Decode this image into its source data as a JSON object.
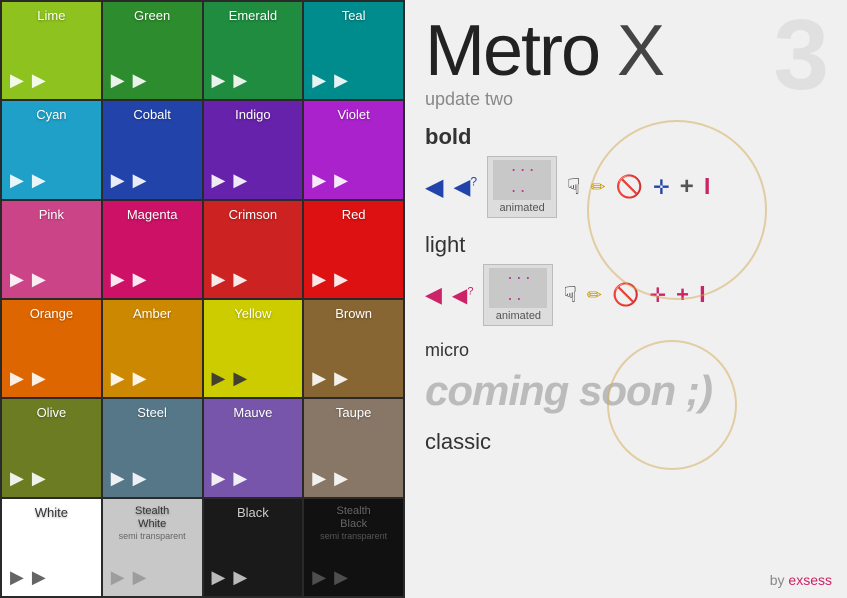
{
  "app": {
    "title": "Metro X",
    "title_prefix": "Metro ",
    "title_x": "X",
    "badge": "3",
    "subtitle": "update two",
    "by": "by exsess"
  },
  "sections": [
    {
      "id": "bold",
      "label": "bold",
      "type": "cursor-row",
      "animated_label": "animated"
    },
    {
      "id": "light",
      "label": "light",
      "type": "cursor-row",
      "animated_label": "animated"
    },
    {
      "id": "micro",
      "label": "micro",
      "type": "coming-soon",
      "coming_soon_text": "coming soon ;)"
    },
    {
      "id": "classic",
      "label": "classic",
      "type": "classic"
    }
  ],
  "color_tiles": [
    {
      "label": "Lime",
      "bg": "#8dc21f",
      "row": 1,
      "col": 1
    },
    {
      "label": "Green",
      "bg": "#2d8c2d",
      "row": 1,
      "col": 2
    },
    {
      "label": "Emerald",
      "bg": "#1f8c3f",
      "row": 1,
      "col": 3
    },
    {
      "label": "Teal",
      "bg": "#008c8c",
      "row": 1,
      "col": 4
    },
    {
      "label": "Cyan",
      "bg": "#1fa0c8",
      "row": 2,
      "col": 1
    },
    {
      "label": "Cobalt",
      "bg": "#2244aa",
      "row": 2,
      "col": 2
    },
    {
      "label": "Indigo",
      "bg": "#6622aa",
      "row": 2,
      "col": 3
    },
    {
      "label": "Violet",
      "bg": "#aa22cc",
      "row": 2,
      "col": 4
    },
    {
      "label": "Pink",
      "bg": "#cc4488",
      "row": 3,
      "col": 1
    },
    {
      "label": "Magenta",
      "bg": "#cc1166",
      "row": 3,
      "col": 2
    },
    {
      "label": "Crimson",
      "bg": "#cc2222",
      "row": 3,
      "col": 3
    },
    {
      "label": "Red",
      "bg": "#dd1111",
      "row": 3,
      "col": 4
    },
    {
      "label": "Orange",
      "bg": "#dd6600",
      "row": 4,
      "col": 1
    },
    {
      "label": "Amber",
      "bg": "#cc8800",
      "row": 4,
      "col": 2
    },
    {
      "label": "Yellow",
      "bg": "#cccc00",
      "row": 4,
      "col": 3
    },
    {
      "label": "Brown",
      "bg": "#886633",
      "row": 4,
      "col": 4
    },
    {
      "label": "Olive",
      "bg": "#6b7c22",
      "row": 5,
      "col": 1
    },
    {
      "label": "Steel",
      "bg": "#557788",
      "row": 5,
      "col": 2
    },
    {
      "label": "Mauve",
      "bg": "#7755aa",
      "row": 5,
      "col": 3
    },
    {
      "label": "Taupe",
      "bg": "#887766",
      "row": 5,
      "col": 4
    },
    {
      "label": "White",
      "bg": "#ffffff",
      "dark": true,
      "row": 6,
      "col": 1
    },
    {
      "label": "Stealth\nWhite",
      "bg": "#c8c8c8",
      "dark": true,
      "row": 6,
      "col": 2,
      "sub": "semi transparent"
    },
    {
      "label": "Black",
      "bg": "#1a1a1a",
      "row": 6,
      "col": 3
    },
    {
      "label": "Stealth\nBlack",
      "bg": "#111111",
      "dim": true,
      "row": 6,
      "col": 4,
      "sub": "semi transparent"
    }
  ]
}
